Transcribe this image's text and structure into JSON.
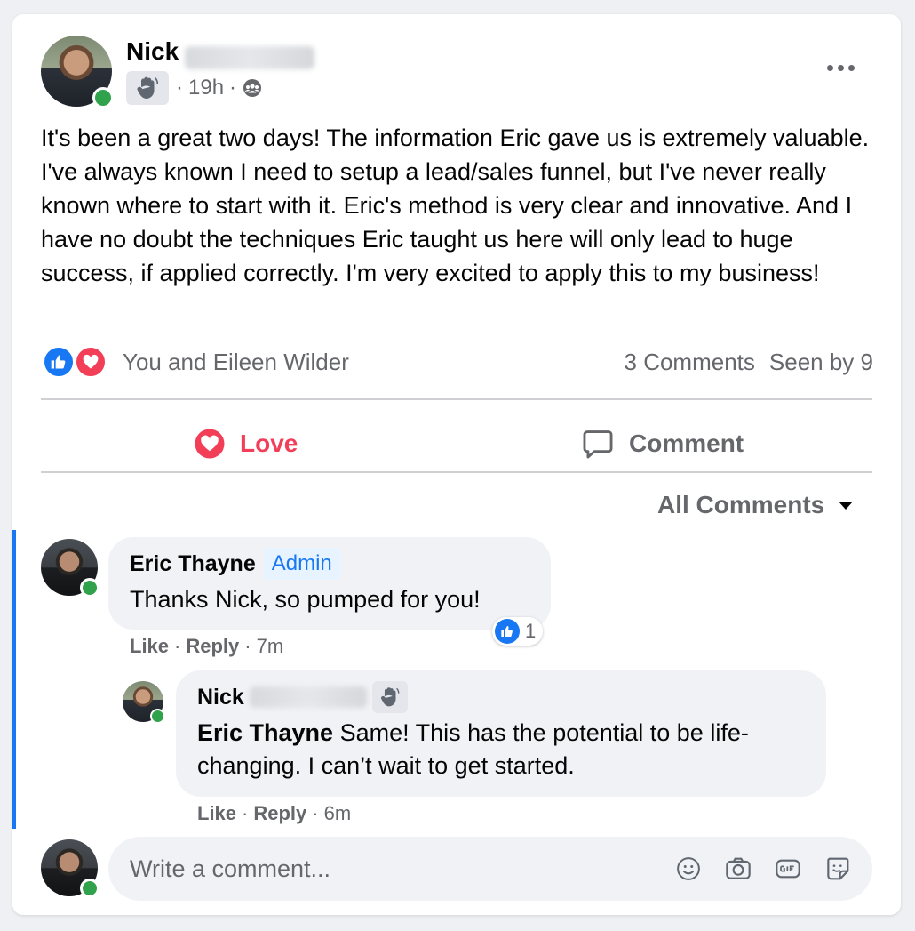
{
  "post": {
    "author_first_name": "Nick",
    "time": "19h",
    "separator": "·",
    "body": "It's been a great two days! The information Eric gave us is extremely valuable. I've always known I need to setup a lead/sales funnel, but I've never really known where to start with it. Eric's method is very clear and innovative. And I have no doubt the techniques Eric taught us here will only lead to huge success, if applied correctly. I'm very excited to apply this to my business!",
    "reactions_text": "You and Eileen Wilder",
    "comments_count": "3 Comments",
    "seen_by": "Seen by 9"
  },
  "actions": {
    "love_label": "Love",
    "comment_label": "Comment"
  },
  "comments_filter": "All Comments",
  "comments": [
    {
      "author": "Eric Thayne",
      "badge": "Admin",
      "text": "Thanks Nick, so pumped for you!",
      "like_label": "Like",
      "reply_label": "Reply",
      "time": "7m",
      "reaction_count": "1"
    }
  ],
  "reply": {
    "author_first_name": "Nick",
    "mention": "Eric Thayne",
    "text": " Same! This has the potential to be life-changing. I can’t wait to get started.",
    "like_label": "Like",
    "reply_label": "Reply",
    "time": "6m"
  },
  "composer": {
    "placeholder": "Write a comment..."
  },
  "icons": {
    "more": "more-options-icon",
    "wave": "wave-badge-icon",
    "audience": "group-audience-icon",
    "like": "like-reaction-icon",
    "love": "love-reaction-icon",
    "comment": "comment-bubble-icon",
    "emoji": "emoji-icon",
    "camera": "camera-icon",
    "gif": "gif-icon",
    "sticker": "sticker-icon"
  },
  "colors": {
    "accent": "#1877f2",
    "love": "#f33e58",
    "online": "#31a24c",
    "secondary_text": "#65676b"
  }
}
